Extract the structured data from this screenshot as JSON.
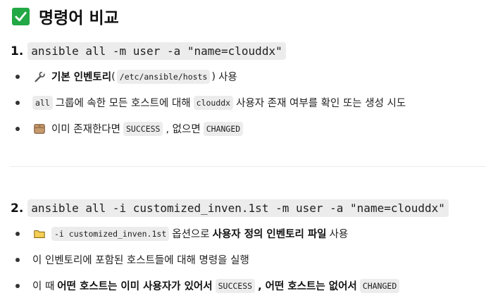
{
  "title": "명령어 비교",
  "items": [
    {
      "number": "1.",
      "command": "ansible all -m user -a \"name=clouddx\"",
      "bullets": [
        {
          "icon": "wrench-icon",
          "bold": "기본 인벤토리",
          "paren_open": "(",
          "code": "/etc/ansible/hosts",
          "paren_close": ")",
          "text": "사용"
        },
        {
          "code1": "all",
          "text1": "그룹에 속한 모든 호스트에 대해",
          "code2": "clouddx",
          "text2": "사용자 존재 여부를 확인 또는 생성 시도"
        },
        {
          "icon": "package-icon",
          "text1": "이미 존재한다면",
          "code1": "SUCCESS",
          "text2": ", 없으면",
          "code2": "CHANGED"
        }
      ]
    },
    {
      "number": "2.",
      "command": "ansible all -i customized_inven.1st -m user -a \"name=clouddx\"",
      "bullets": [
        {
          "icon": "folder-icon",
          "code": "-i customized_inven.1st",
          "text1": "옵션으로",
          "bold": "사용자 정의 인벤토리 파일",
          "text2": "사용"
        },
        {
          "text": "이 인벤토리에 포함된 호스트들에 대해 명령을 실행"
        },
        {
          "text1": "이 때",
          "bold1": "어떤 호스트는 이미 사용자가 있어서",
          "code1": "SUCCESS",
          "bold2": ", 어떤 호스트는 없어서",
          "code2": "CHANGED"
        }
      ]
    }
  ],
  "colors": {
    "check": "#22a845",
    "code_bg": "#ececec"
  }
}
